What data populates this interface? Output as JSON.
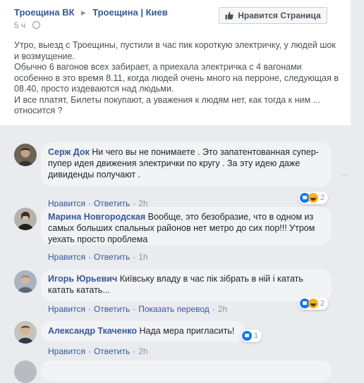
{
  "post": {
    "author": "Троещина ВК",
    "group": "Троещина | Киев",
    "time": "5 ч",
    "like_page_label": "Нравится Страница",
    "paragraphs": [
      "Утро, выезд с Троещины, пустили в час пик короткую электричку, у людей шок и возмущение.",
      "Обычно 6 вагонов всех забирает, а приехала электричка с 4 вагонами особенно в это время 8.11, когда людей очень много на перроне, следующая в 08.40, просто издеваются над людьми.",
      "И все платят, Билеты покупают, а уважения к людям нет, как тогда к ним ... относится ?"
    ]
  },
  "comments": [
    {
      "name": "Серж Док",
      "text": "Ни чего вы не понимаете . Это запатентованная супер-пупер идея движения электрички по кругу . За эту идею даже дивиденды получают .",
      "like_label": "Нравится",
      "reply_label": "Ответить",
      "time": "2h",
      "reaction_count": "2"
    },
    {
      "name": "Марина Новгородская",
      "text": "Вообще, это безобразие, что в одном из самых больших спальных районов нет метро до сих пор!!! Утром уехать просто проблема",
      "like_label": "Нравится",
      "reply_label": "Ответить",
      "time": "1h"
    },
    {
      "name": "Игорь Юрьевич",
      "text": "Київську владу в час пік зібрать в ній і катать катать катать...",
      "like_label": "Нравится",
      "reply_label": "Ответить",
      "translate_label": "Показать перевод",
      "time": "2h",
      "reaction_count": "2"
    },
    {
      "name": "Александр Ткаченко",
      "text": "Нада мера пригласить!",
      "like_label": "Нравится",
      "reply_label": "Ответить",
      "time": "2h",
      "reaction_count": "1"
    }
  ],
  "icons": {
    "thumb": "thumbs-up-icon",
    "globe": "globe-icon",
    "more": "more-options-icon",
    "like_reaction": "like-reaction-icon",
    "haha_reaction": "haha-reaction-icon"
  },
  "colors": {
    "link": "#385898",
    "background": "#e9ebee",
    "bubble": "#f2f3f5",
    "like_blue": "#1877f2"
  }
}
